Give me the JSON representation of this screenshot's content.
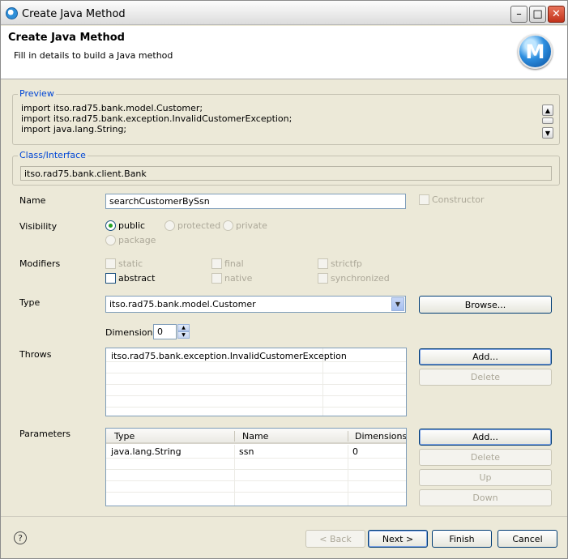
{
  "window": {
    "title": "Create Java Method",
    "controls": {
      "minimize": "–",
      "maximize": "□",
      "close": "✕"
    }
  },
  "header": {
    "title": "Create Java Method",
    "description": "Fill in details to build a Java method",
    "icon_letter": "M"
  },
  "preview": {
    "legend": "Preview",
    "lines": [
      "import itso.rad75.bank.model.Customer;",
      "import itso.rad75.bank.exception.InvalidCustomerException;",
      "import java.lang.String;"
    ]
  },
  "class_interface": {
    "legend": "Class/Interface",
    "value": "itso.rad75.bank.client.Bank"
  },
  "name": {
    "label": "Name",
    "value": "searchCustomerBySsn",
    "constructor_label": "Constructor"
  },
  "visibility": {
    "label": "Visibility",
    "options": [
      "public",
      "protected",
      "private",
      "package"
    ],
    "selected": "public"
  },
  "modifiers": {
    "label": "Modifiers",
    "options": [
      "static",
      "final",
      "strictfp",
      "abstract",
      "native",
      "synchronized"
    ]
  },
  "type": {
    "label": "Type",
    "value": "itso.rad75.bank.model.Customer",
    "browse_label": "Browse...",
    "dimensions_label": "Dimensions",
    "dimensions_value": "0"
  },
  "throws": {
    "label": "Throws",
    "items": [
      "itso.rad75.bank.exception.InvalidCustomerException"
    ],
    "add_label": "Add...",
    "delete_label": "Delete"
  },
  "parameters": {
    "label": "Parameters",
    "columns": [
      "Type",
      "Name",
      "Dimensions"
    ],
    "rows": [
      {
        "type": "java.lang.String",
        "name": "ssn",
        "dimensions": "0"
      }
    ],
    "add_label": "Add...",
    "delete_label": "Delete",
    "up_label": "Up",
    "down_label": "Down"
  },
  "footer": {
    "help": "?",
    "back_label": "< Back",
    "next_label": "Next >",
    "finish_label": "Finish",
    "cancel_label": "Cancel"
  },
  "colors": {
    "legend": "#0046d5",
    "radio_selected": "#21a121",
    "dialog_bg": "#ece9d8"
  }
}
